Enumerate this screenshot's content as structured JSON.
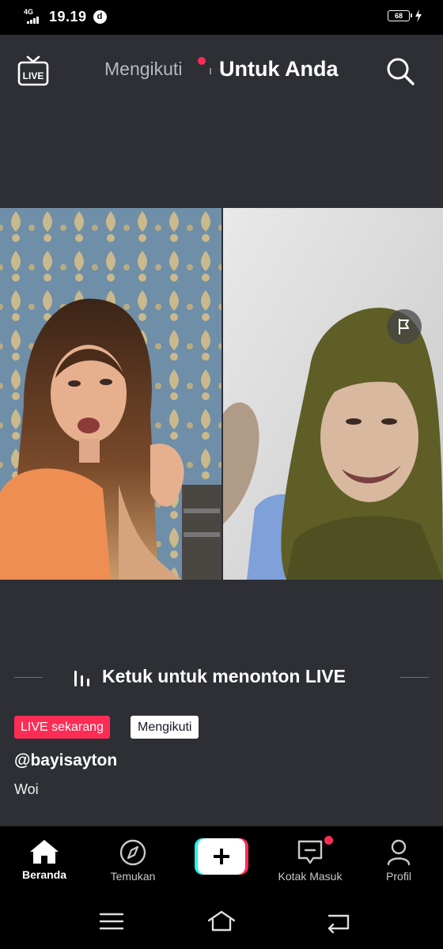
{
  "status_bar": {
    "network": "4G",
    "time": "19.19",
    "app_badge": "d",
    "battery": "68"
  },
  "header": {
    "live_icon_label": "LIVE",
    "tab_following": "Mengikuti",
    "tab_foryou": "Untuk Anda"
  },
  "live": {
    "tap_prompt": "Ketuk untuk menonton LIVE",
    "badge_live": "LIVE sekarang",
    "badge_following": "Mengikuti",
    "username": "@bayisayton",
    "caption": "Woi"
  },
  "bottom_nav": {
    "items": [
      {
        "label": "Beranda",
        "icon": "home-icon",
        "active": true
      },
      {
        "label": "Temukan",
        "icon": "compass-icon",
        "active": false
      },
      {
        "label": "",
        "icon": "plus-icon",
        "active": false
      },
      {
        "label": "Kotak Masuk",
        "icon": "inbox-icon",
        "active": false
      },
      {
        "label": "Profil",
        "icon": "profile-icon",
        "active": false
      }
    ]
  },
  "colors": {
    "background": "#2d2f35",
    "accent_pink": "#fe2c55",
    "accent_cyan": "#25f4ee",
    "nav_bg": "#000000"
  }
}
